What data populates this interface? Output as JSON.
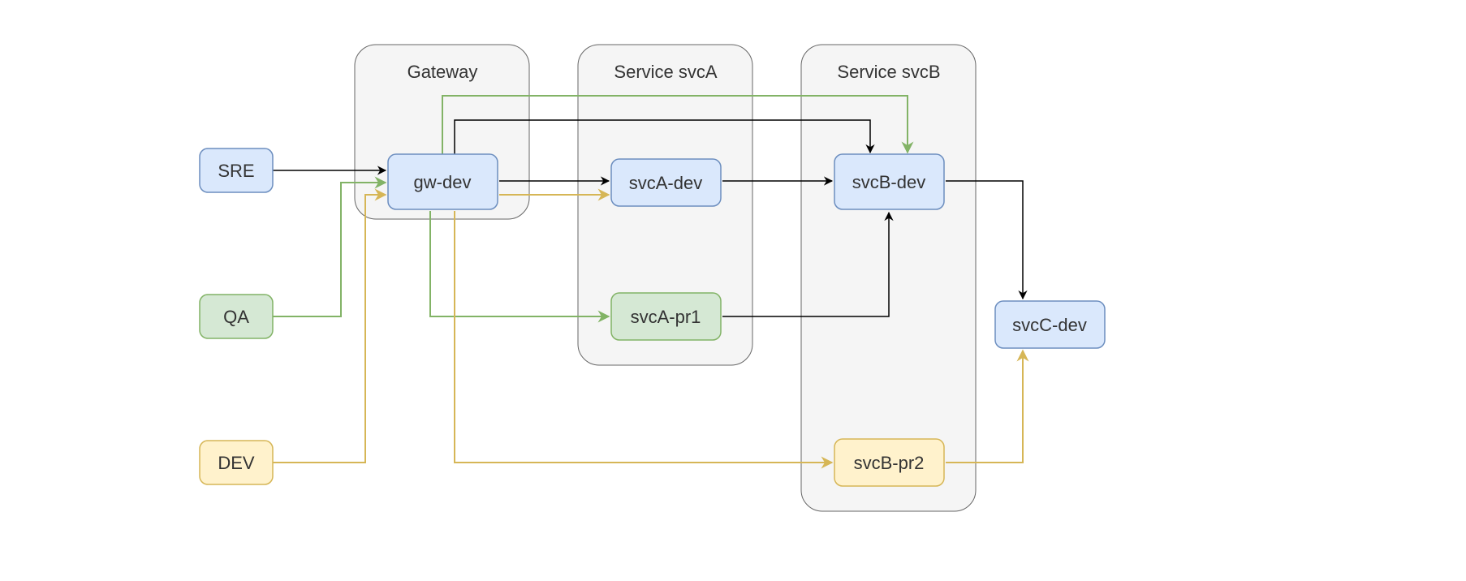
{
  "groups": {
    "gateway": {
      "label": "Gateway"
    },
    "svcA": {
      "label": "Service svcA"
    },
    "svcB": {
      "label": "Service svcB"
    }
  },
  "nodes": {
    "sre": {
      "label": "SRE"
    },
    "qa": {
      "label": "QA"
    },
    "dev": {
      "label": "DEV"
    },
    "gw_dev": {
      "label": "gw-dev"
    },
    "svcA_dev": {
      "label": "svcA-dev"
    },
    "svcA_pr1": {
      "label": "svcA-pr1"
    },
    "svcB_dev": {
      "label": "svcB-dev"
    },
    "svcB_pr2": {
      "label": "svcB-pr2"
    },
    "svcC_dev": {
      "label": "svcC-dev"
    }
  },
  "colors": {
    "blue_fill": "#dae8fc",
    "blue_stroke": "#6c8ebf",
    "green_fill": "#d5e8d4",
    "green_stroke": "#82b366",
    "yellow_fill": "#fff2cc",
    "yellow_stroke": "#d6b656",
    "group_fill": "#f5f5f5",
    "group_stroke": "#666666",
    "edge_black": "#000000"
  },
  "edges": [
    {
      "from": "sre",
      "to": "gw_dev",
      "color": "black"
    },
    {
      "from": "qa",
      "to": "gw_dev",
      "color": "green"
    },
    {
      "from": "dev",
      "to": "gw_dev",
      "color": "yellow"
    },
    {
      "from": "gw_dev",
      "to": "svcB_dev",
      "color": "black"
    },
    {
      "from": "gw_dev",
      "to": "svcB_dev",
      "color": "green"
    },
    {
      "from": "gw_dev",
      "to": "svcA_dev",
      "color": "black"
    },
    {
      "from": "gw_dev",
      "to": "svcA_dev",
      "color": "yellow"
    },
    {
      "from": "gw_dev",
      "to": "svcA_pr1",
      "color": "green"
    },
    {
      "from": "gw_dev",
      "to": "svcB_pr2",
      "color": "yellow"
    },
    {
      "from": "svcA_dev",
      "to": "svcB_dev",
      "color": "black"
    },
    {
      "from": "svcA_pr1",
      "to": "svcB_dev",
      "color": "black"
    },
    {
      "from": "svcB_dev",
      "to": "svcC_dev",
      "color": "black"
    },
    {
      "from": "svcB_pr2",
      "to": "svcC_dev",
      "color": "yellow"
    }
  ]
}
